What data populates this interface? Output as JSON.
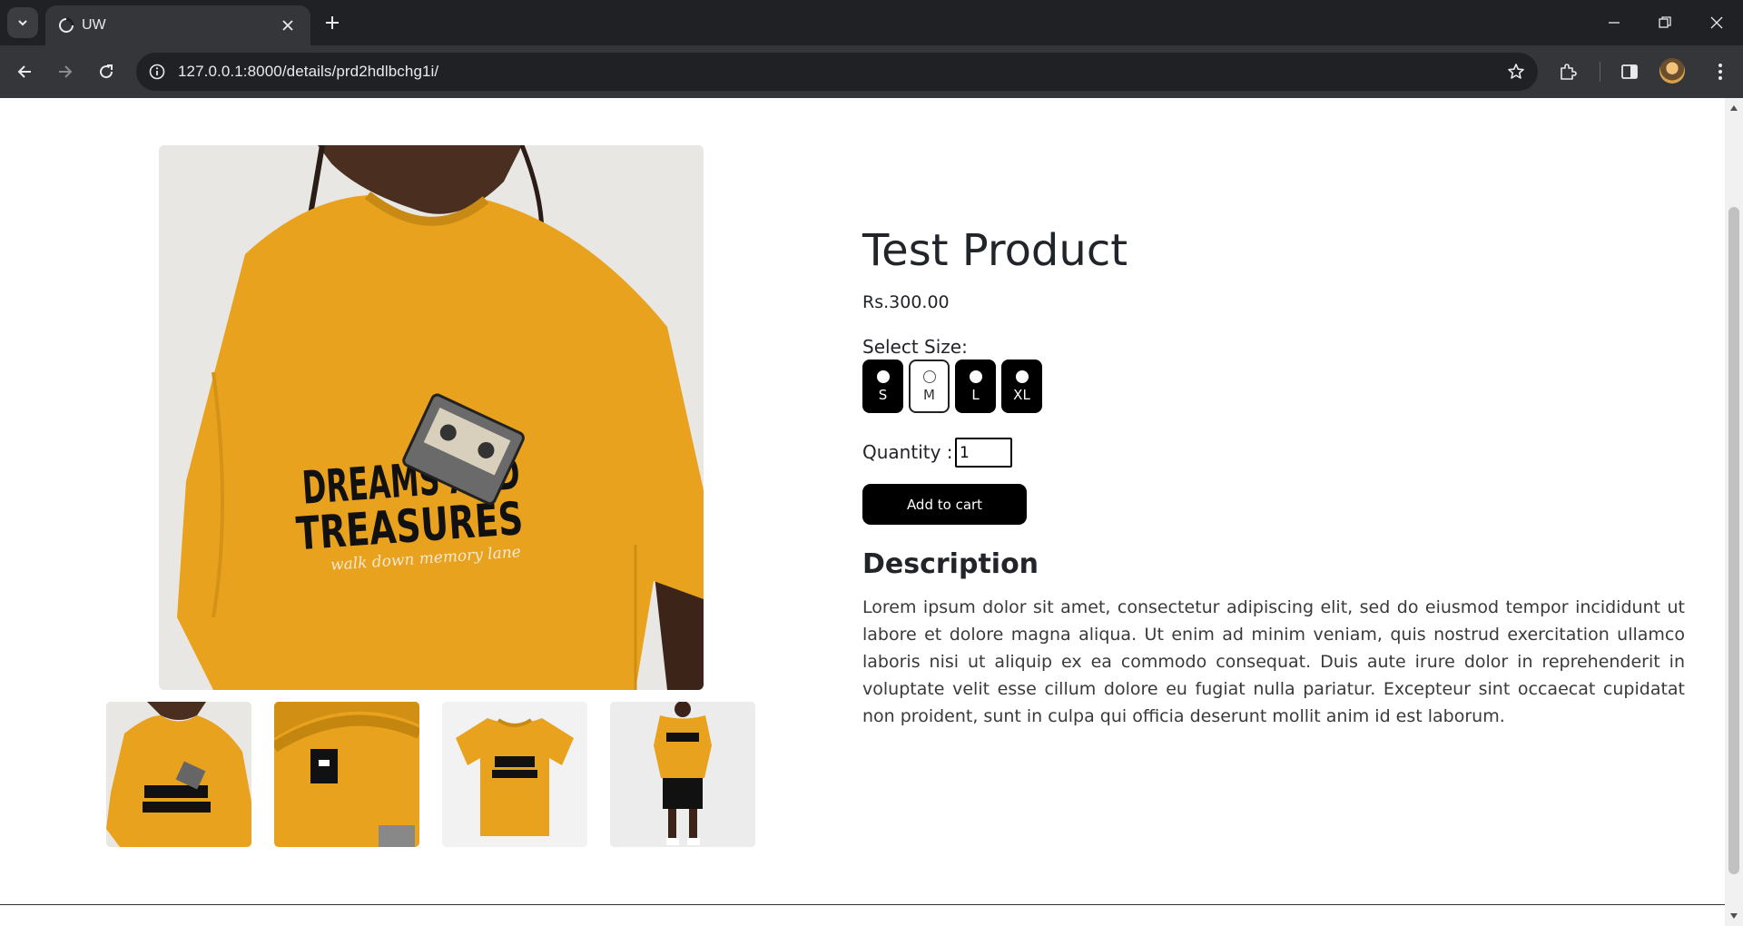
{
  "browser": {
    "tab_title": "UW",
    "url": "127.0.0.1:8000/details/prd2hdlbchg1i/"
  },
  "product": {
    "title": "Test Product",
    "price": "Rs.300.00",
    "size_label": "Select Size:",
    "sizes": [
      {
        "label": "S",
        "selected": false
      },
      {
        "label": "M",
        "selected": true
      },
      {
        "label": "L",
        "selected": false
      },
      {
        "label": "XL",
        "selected": false
      }
    ],
    "quantity_label": "Quantity :",
    "quantity_value": "1",
    "add_to_cart": "Add to cart",
    "description_title": "Description",
    "description": "Lorem ipsum dolor sit amet, consectetur adipiscing elit, sed do eiusmod tempor incididunt ut labore et dolore magna aliqua. Ut enim ad minim veniam, quis nostrud exercitation ullamco laboris nisi ut aliquip ex ea commodo consequat. Duis aute irure dolor in reprehenderit in voluptate velit esse cillum dolore eu fugiat nulla pariatur. Excepteur sint occaecat cupidatat non proident, sunt in culpa qui officia deserunt mollit anim id est laborum."
  },
  "images": {
    "main_print_line1": "DREAMS AND",
    "main_print_line2": "TREASURES",
    "main_print_script": "walk down memory lane",
    "shirt_color": "#e8a21e",
    "thumbnails": [
      "model-front",
      "collar-closeup",
      "flat-lay",
      "full-body"
    ]
  }
}
